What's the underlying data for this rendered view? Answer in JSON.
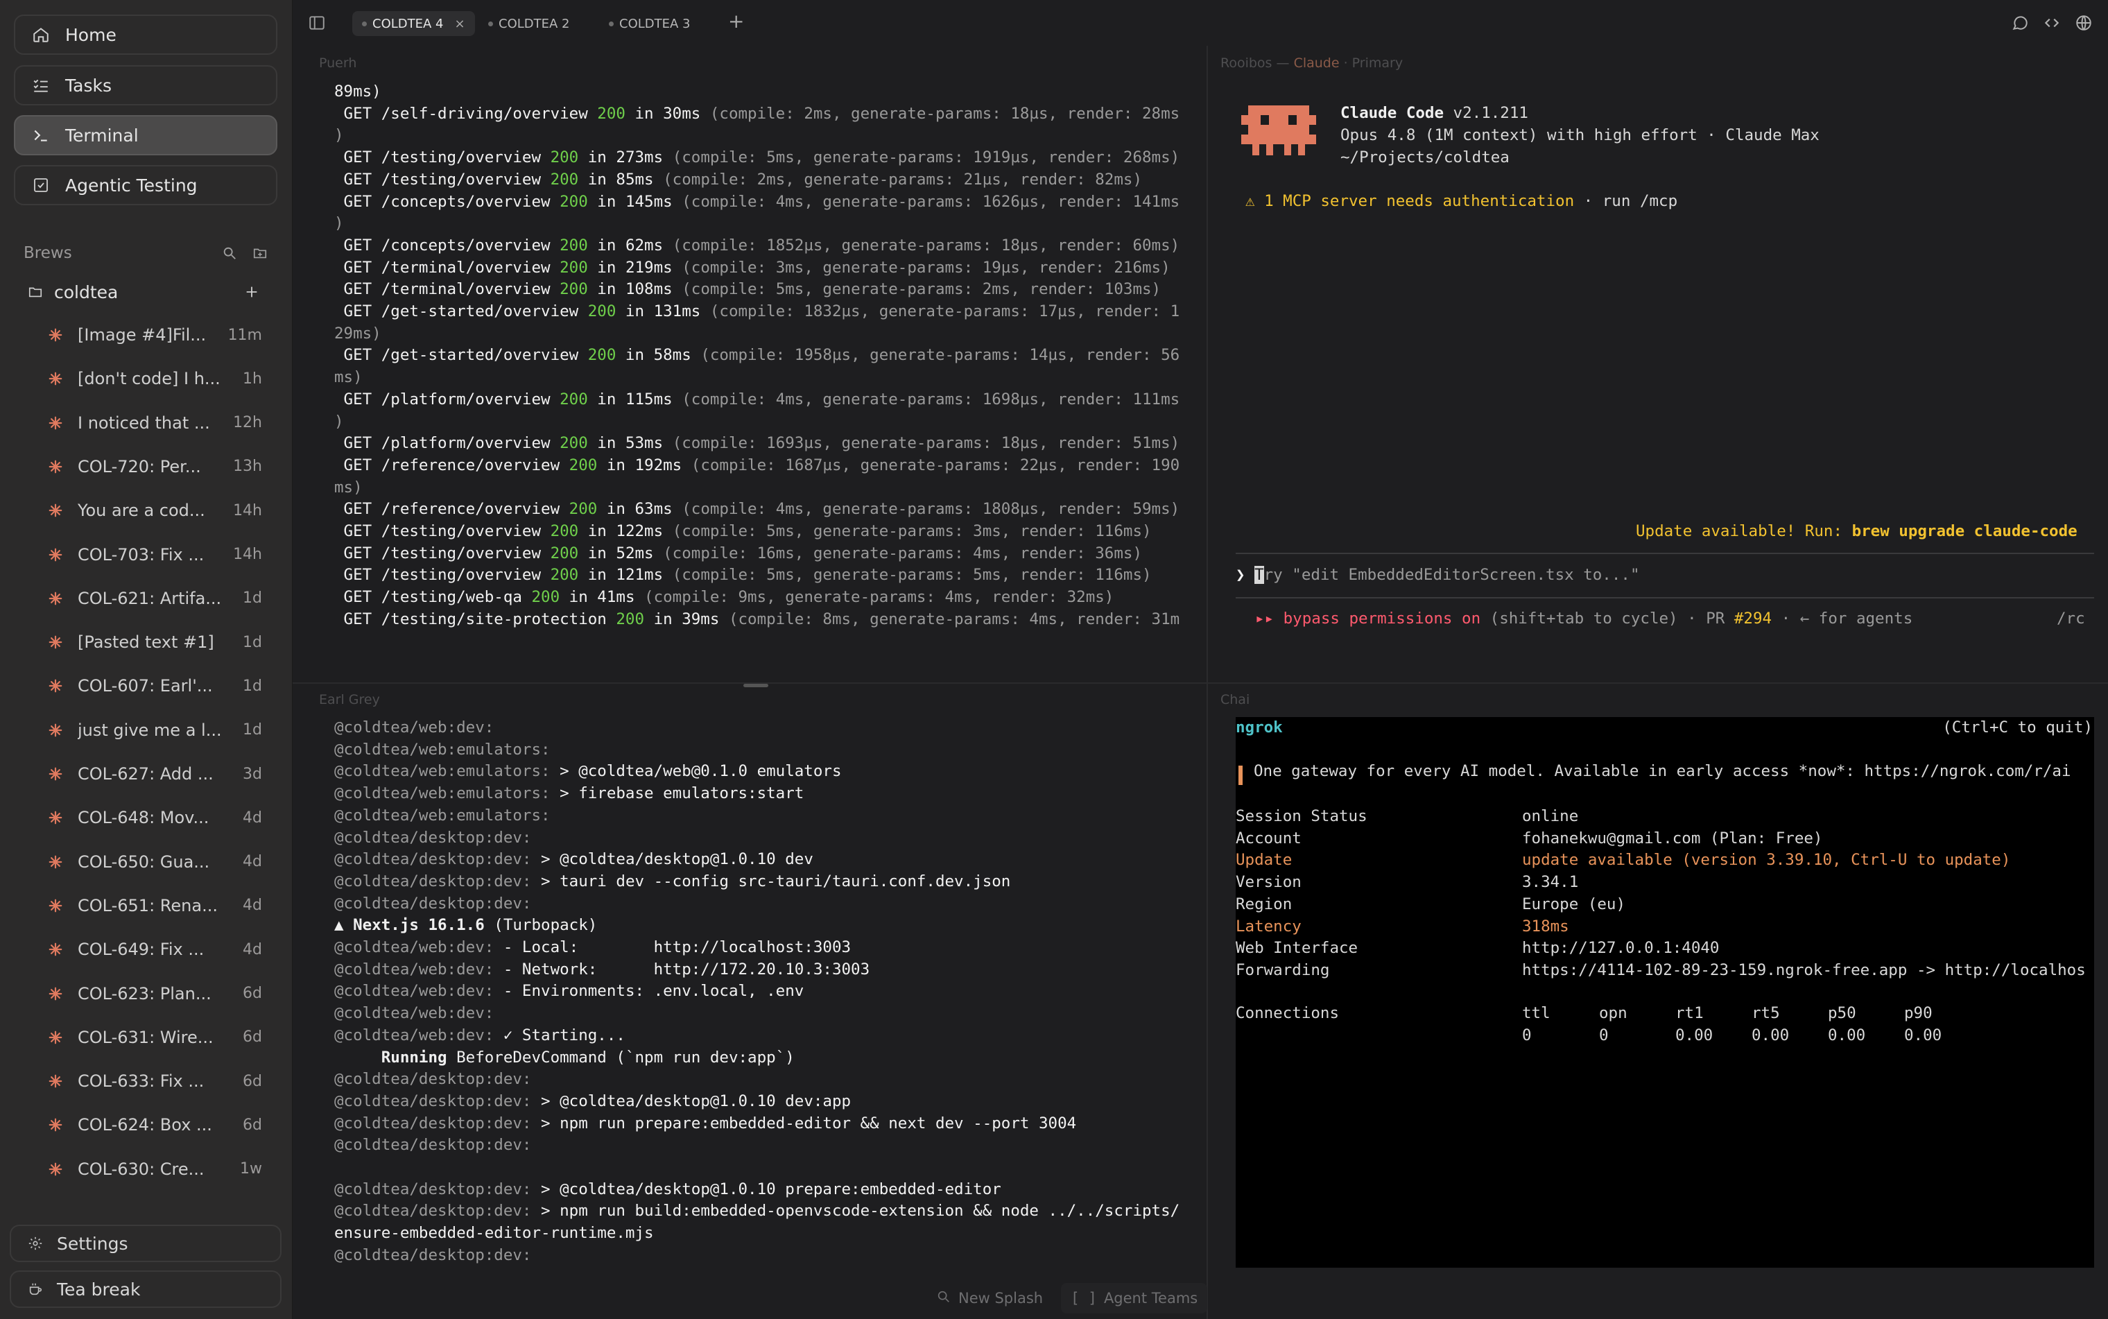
{
  "sidebar": {
    "nav": [
      {
        "label": "Home",
        "icon": "home-icon"
      },
      {
        "label": "Tasks",
        "icon": "tasks-icon"
      },
      {
        "label": "Terminal",
        "icon": "terminal-icon"
      },
      {
        "label": "Agentic Testing",
        "icon": "checkbox-icon"
      }
    ],
    "brews_label": "Brews",
    "folder": "coldtea",
    "items": [
      {
        "label": "[Image #4]Fil...",
        "time": "11m"
      },
      {
        "label": "[don't code] I h...",
        "time": "1h"
      },
      {
        "label": "I noticed that ...",
        "time": "12h"
      },
      {
        "label": "COL-720: Per...",
        "time": "13h"
      },
      {
        "label": "You are a cod...",
        "time": "14h"
      },
      {
        "label": "COL-703: Fix ...",
        "time": "14h"
      },
      {
        "label": "COL-621: Artifa...",
        "time": "1d"
      },
      {
        "label": "[Pasted text #1]",
        "time": "1d"
      },
      {
        "label": "COL-607: Earl'...",
        "time": "1d"
      },
      {
        "label": "just give me a l...",
        "time": "1d"
      },
      {
        "label": "COL-627: Add ...",
        "time": "3d"
      },
      {
        "label": "COL-648: Mov...",
        "time": "4d"
      },
      {
        "label": "COL-650: Gua...",
        "time": "4d"
      },
      {
        "label": "COL-651: Rena...",
        "time": "4d"
      },
      {
        "label": "COL-649: Fix ...",
        "time": "4d"
      },
      {
        "label": "COL-623: Plan...",
        "time": "6d"
      },
      {
        "label": "COL-631: Wire...",
        "time": "6d"
      },
      {
        "label": "COL-633: Fix ...",
        "time": "6d"
      },
      {
        "label": "COL-624: Box ...",
        "time": "6d"
      },
      {
        "label": "COL-630: Cre...",
        "time": "1w"
      }
    ],
    "settings": "Settings",
    "tea_break": "Tea break"
  },
  "tabs": [
    {
      "label": "COLDTEA 4",
      "close": "×"
    },
    {
      "label": "COLDTEA 2"
    },
    {
      "label": "COLDTEA 3"
    }
  ],
  "add_tab": "+",
  "panes": {
    "top_left_title": "Puerh",
    "top_right_title_a": "Rooibos",
    "top_right_title_sep": " — ",
    "top_right_title_b": "Claude",
    "top_right_title_c": " · Primary",
    "bottom_left_title": "Earl Grey",
    "bottom_right_title": "Chai"
  },
  "puerh_lines": [
    {
      "pre": "",
      "path": "89ms)",
      "code": "",
      "time": "",
      "rest": ""
    },
    {
      "pre": " GET ",
      "path": "/self-driving/overview ",
      "code": "200",
      "time": " in 30ms ",
      "rest": "(compile: 2ms, generate-params: 18µs, render: 28ms"
    },
    {
      "pre": "",
      "path": "",
      "code": "",
      "time": "",
      "rest": ")"
    },
    {
      "pre": " GET ",
      "path": "/testing/overview ",
      "code": "200",
      "time": " in 273ms ",
      "rest": "(compile: 5ms, generate-params: 1919µs, render: 268ms)"
    },
    {
      "pre": " GET ",
      "path": "/testing/overview ",
      "code": "200",
      "time": " in 85ms ",
      "rest": "(compile: 2ms, generate-params: 21µs, render: 82ms)"
    },
    {
      "pre": " GET ",
      "path": "/concepts/overview ",
      "code": "200",
      "time": " in 145ms ",
      "rest": "(compile: 4ms, generate-params: 1626µs, render: 141ms"
    },
    {
      "pre": "",
      "path": "",
      "code": "",
      "time": "",
      "rest": ")"
    },
    {
      "pre": " GET ",
      "path": "/concepts/overview ",
      "code": "200",
      "time": " in 62ms ",
      "rest": "(compile: 1852µs, generate-params: 18µs, render: 60ms)"
    },
    {
      "pre": " GET ",
      "path": "/terminal/overview ",
      "code": "200",
      "time": " in 219ms ",
      "rest": "(compile: 3ms, generate-params: 19µs, render: 216ms)"
    },
    {
      "pre": " GET ",
      "path": "/terminal/overview ",
      "code": "200",
      "time": " in 108ms ",
      "rest": "(compile: 5ms, generate-params: 2ms, render: 103ms)"
    },
    {
      "pre": " GET ",
      "path": "/get-started/overview ",
      "code": "200",
      "time": " in 131ms ",
      "rest": "(compile: 1832µs, generate-params: 17µs, render: 1"
    },
    {
      "pre": "",
      "path": "",
      "code": "",
      "time": "",
      "rest": "29ms)"
    },
    {
      "pre": " GET ",
      "path": "/get-started/overview ",
      "code": "200",
      "time": " in 58ms ",
      "rest": "(compile: 1958µs, generate-params: 14µs, render: 56"
    },
    {
      "pre": "",
      "path": "",
      "code": "",
      "time": "",
      "rest": "ms)"
    },
    {
      "pre": " GET ",
      "path": "/platform/overview ",
      "code": "200",
      "time": " in 115ms ",
      "rest": "(compile: 4ms, generate-params: 1698µs, render: 111ms"
    },
    {
      "pre": "",
      "path": "",
      "code": "",
      "time": "",
      "rest": ")"
    },
    {
      "pre": " GET ",
      "path": "/platform/overview ",
      "code": "200",
      "time": " in 53ms ",
      "rest": "(compile: 1693µs, generate-params: 18µs, render: 51ms)"
    },
    {
      "pre": " GET ",
      "path": "/reference/overview ",
      "code": "200",
      "time": " in 192ms ",
      "rest": "(compile: 1687µs, generate-params: 22µs, render: 190"
    },
    {
      "pre": "",
      "path": "",
      "code": "",
      "time": "",
      "rest": "ms)"
    },
    {
      "pre": " GET ",
      "path": "/reference/overview ",
      "code": "200",
      "time": " in 63ms ",
      "rest": "(compile: 4ms, generate-params: 1808µs, render: 59ms)"
    },
    {
      "pre": " GET ",
      "path": "/testing/overview ",
      "code": "200",
      "time": " in 122ms ",
      "rest": "(compile: 5ms, generate-params: 3ms, render: 116ms)"
    },
    {
      "pre": " GET ",
      "path": "/testing/overview ",
      "code": "200",
      "time": " in 52ms ",
      "rest": "(compile: 16ms, generate-params: 4ms, render: 36ms)"
    },
    {
      "pre": " GET ",
      "path": "/testing/overview ",
      "code": "200",
      "time": " in 121ms ",
      "rest": "(compile: 5ms, generate-params: 5ms, render: 116ms)"
    },
    {
      "pre": " GET ",
      "path": "/testing/web-qa ",
      "code": "200",
      "time": " in 41ms ",
      "rest": "(compile: 9ms, generate-params: 4ms, render: 32ms)"
    },
    {
      "pre": " GET ",
      "path": "/testing/site-protection ",
      "code": "200",
      "time": " in 39ms ",
      "rest": "(compile: 8ms, generate-params: 4ms, render: 31m"
    }
  ],
  "claude": {
    "name": "Claude Code",
    "version": " v2.1.211",
    "model_line": "Opus 4.8 (1M context) with high effort · Claude Max",
    "path": "~/Projects/coldtea",
    "warn_main": "⚠ 1 MCP server needs authentication",
    "warn_tail": " · run /mcp",
    "update_a": "Update available! Run: ",
    "update_b": "brew upgrade claude-code",
    "prompt_symbol": "❯",
    "prompt_cursor": "T",
    "prompt_placeholder": "ry \"edit EmbeddedEditorScreen.tsx to...\"",
    "status_arrows": "▸▸",
    "status_bypass": " bypass permissions on",
    "status_mid": " (shift+tab to cycle) · PR ",
    "status_pr": "#294",
    "status_tail": " · ← for agents",
    "status_rc": "/rc"
  },
  "earlgrey_lines": [
    {
      "tag": "@coldtea/web:dev:",
      "text": ""
    },
    {
      "tag": "@coldtea/web:emulators:",
      "text": ""
    },
    {
      "tag": "@coldtea/web:emulators:",
      "text": " > @coldtea/web@0.1.0 emulators"
    },
    {
      "tag": "@coldtea/web:emulators:",
      "text": " > firebase emulators:start"
    },
    {
      "tag": "@coldtea/web:emulators:",
      "text": ""
    },
    {
      "tag": "@coldtea/desktop:dev:",
      "text": ""
    },
    {
      "tag": "@coldtea/desktop:dev:",
      "text": " > @coldtea/desktop@1.0.10 dev"
    },
    {
      "tag": "@coldtea/desktop:dev:",
      "text": " > tauri dev --config src-tauri/tauri.conf.dev.json"
    },
    {
      "tag": "@coldtea/desktop:dev:",
      "text": ""
    },
    {
      "tag": "",
      "text": "",
      "bold": "▲ Next.js 16.1.6",
      "after": " (Turbopack)"
    },
    {
      "tag": "@coldtea/web:dev:",
      "text": " - Local:        http://localhost:3003"
    },
    {
      "tag": "@coldtea/web:dev:",
      "text": " - Network:      http://172.20.10.3:3003"
    },
    {
      "tag": "@coldtea/web:dev:",
      "text": " - Environments: .env.local, .env"
    },
    {
      "tag": "@coldtea/web:dev:",
      "text": ""
    },
    {
      "tag": "@coldtea/web:dev:",
      "text": " ✓ Starting..."
    },
    {
      "tag": "",
      "text": "",
      "bold": "     Running",
      "after": " BeforeDevCommand (`npm run dev:app`)"
    },
    {
      "tag": "@coldtea/desktop:dev:",
      "text": ""
    },
    {
      "tag": "@coldtea/desktop:dev:",
      "text": " > @coldtea/desktop@1.0.10 dev:app"
    },
    {
      "tag": "@coldtea/desktop:dev:",
      "text": " > npm run prepare:embedded-editor && next dev --port 3004"
    },
    {
      "tag": "@coldtea/desktop:dev:",
      "text": ""
    },
    {
      "tag": "",
      "text": ""
    },
    {
      "tag": "@coldtea/desktop:dev:",
      "text": " > @coldtea/desktop@1.0.10 prepare:embedded-editor"
    },
    {
      "tag": "@coldtea/desktop:dev:",
      "text": " > npm run build:embedded-openvscode-extension && node ../../scripts/"
    },
    {
      "tag": "",
      "text": "ensure-embedded-editor-runtime.mjs"
    },
    {
      "tag": "@coldtea/desktop:dev:",
      "text": ""
    }
  ],
  "ngrok": {
    "title": "ngrok",
    "quit": "(Ctrl+C to quit)",
    "banner": "One gateway for every AI model. Available in early access *now*: https://ngrok.com/r/ai",
    "rows": [
      {
        "k": "Session Status",
        "v": "online",
        "hl": false
      },
      {
        "k": "Account",
        "v": "fohanekwu@gmail.com (Plan: Free)",
        "hl": false
      },
      {
        "k": "Update",
        "v": "update available (version 3.39.10, Ctrl-U to update)",
        "hl": true
      },
      {
        "k": "Version",
        "v": "3.34.1",
        "hl": false
      },
      {
        "k": "Region",
        "v": "Europe (eu)",
        "hl": false
      },
      {
        "k": "Latency",
        "v": "318ms",
        "hl": true
      },
      {
        "k": "Web Interface",
        "v": "http://127.0.0.1:4040",
        "hl": false
      },
      {
        "k": "Forwarding",
        "v": "https://4114-102-89-23-159.ngrok-free.app -> http://localhos",
        "hl": false
      }
    ],
    "conn_label": "Connections",
    "conn_headers": [
      "ttl",
      "opn",
      "rt1",
      "rt5",
      "p50",
      "p90"
    ],
    "conn_values": [
      "0",
      "0",
      "0.00",
      "0.00",
      "0.00",
      "0.00"
    ]
  },
  "bottom_buttons": {
    "new_splash": "New Splash",
    "agent_teams": "Agent Teams"
  },
  "colors": {
    "accent_claude": "#e07a5f",
    "warn_yellow": "#f2c230",
    "bypass_red": "#ff5a6e",
    "ngrok_orange": "#e8935a"
  }
}
